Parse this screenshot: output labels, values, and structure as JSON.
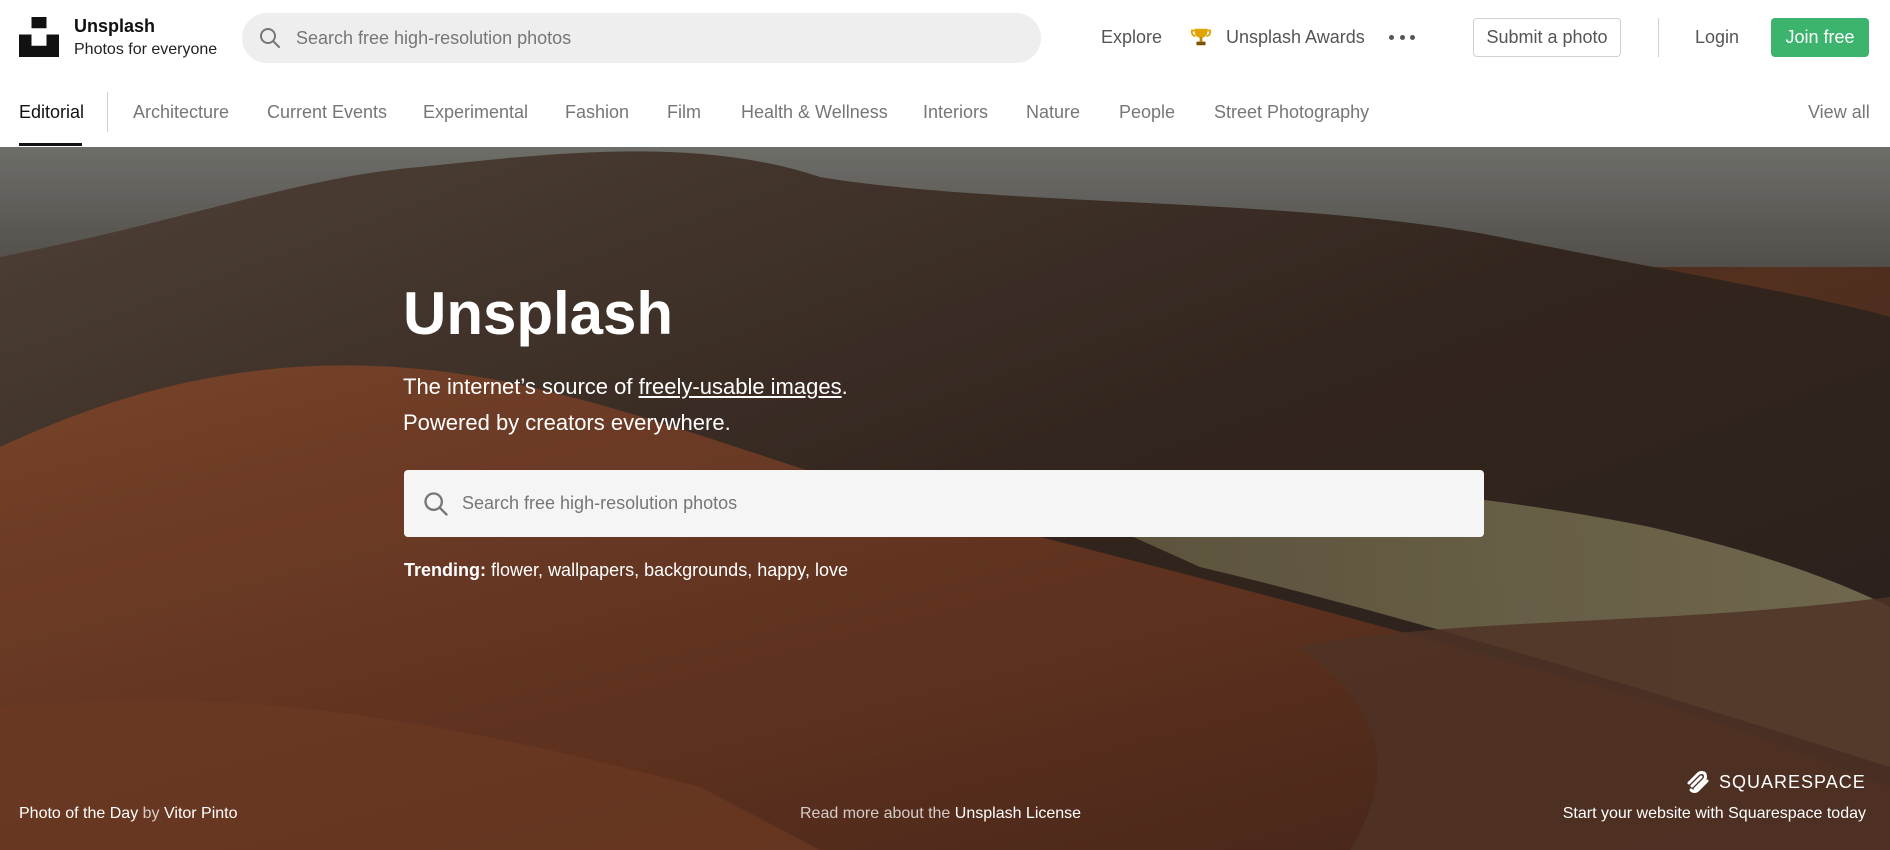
{
  "header": {
    "brand_name": "Unsplash",
    "brand_tagline": "Photos for everyone",
    "search_placeholder": "Search free high-resolution photos",
    "nav": {
      "explore": "Explore",
      "awards": "Unsplash Awards"
    },
    "submit_label": "Submit a photo",
    "login_label": "Login",
    "join_label": "Join free",
    "join_color": "#3cb46e"
  },
  "categories": {
    "active": "Editorial",
    "items": [
      "Architecture",
      "Current Events",
      "Experimental",
      "Fashion",
      "Film",
      "Health & Wellness",
      "Interiors",
      "Nature",
      "People",
      "Street Photography"
    ],
    "view_all": "View all"
  },
  "hero": {
    "title": "Unsplash",
    "subtitle_prefix": "The internet’s source of ",
    "subtitle_link": "freely-usable images",
    "subtitle_suffix": ".",
    "subtitle_line2": "Powered by creators everywhere.",
    "search_placeholder": "Search free high-resolution photos",
    "trending_label": "Trending:",
    "trending_terms": [
      "flower",
      "wallpapers",
      "backgrounds",
      "happy",
      "love"
    ]
  },
  "footer": {
    "photo_of_day_label": "Photo of the Day",
    "by": "by",
    "photographer": "Vitor Pinto",
    "license_prefix": "Read more about the",
    "license_link": "Unsplash License",
    "sponsor_logo_text": "SQUARESPACE",
    "sponsor_cta": "Start your website with Squarespace today"
  },
  "icons": {
    "logo": "unsplash-logo",
    "search": "search-icon",
    "awards": "trophy-icon",
    "more": "more-dots-icon",
    "sponsor": "squarespace-logo-icon"
  }
}
